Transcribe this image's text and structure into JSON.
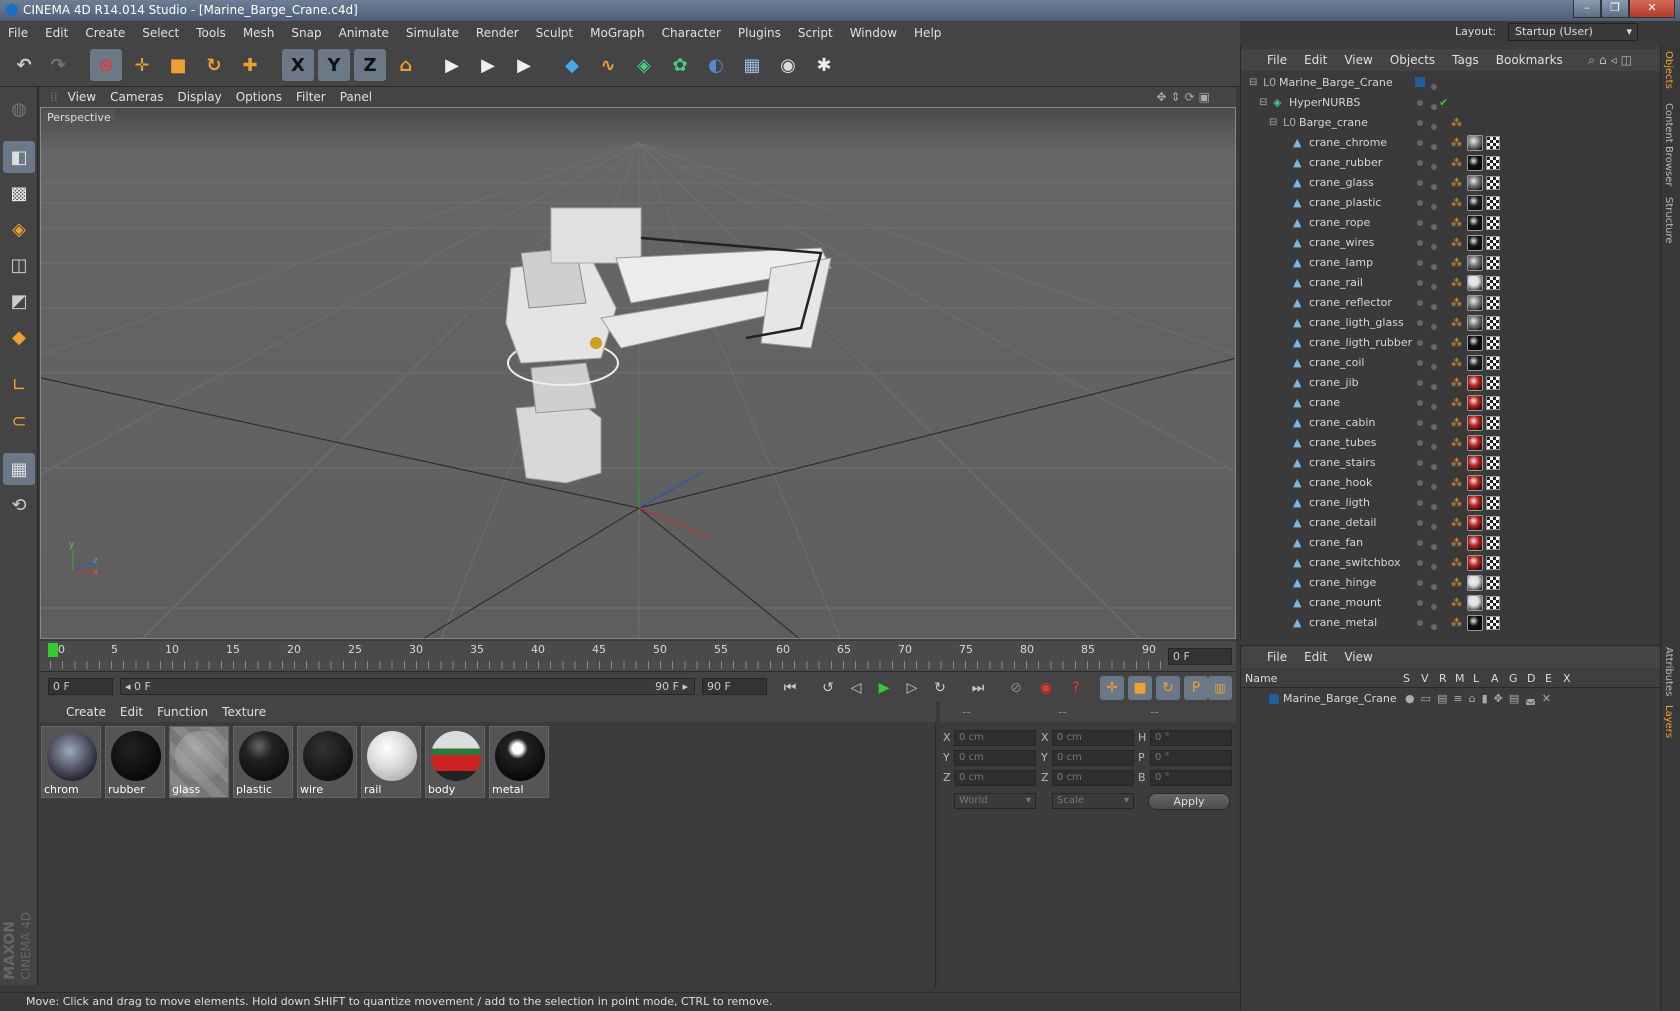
{
  "window": {
    "title": "CINEMA 4D R14.014 Studio - [Marine_Barge_Crane.c4d]",
    "minimize": "–",
    "maximize": "❐",
    "close": "✕"
  },
  "layout": {
    "label": "Layout:",
    "value": "Startup (User)"
  },
  "menubar": [
    "File",
    "Edit",
    "Create",
    "Select",
    "Tools",
    "Mesh",
    "Snap",
    "Animate",
    "Simulate",
    "Render",
    "Sculpt",
    "MoGraph",
    "Character",
    "Plugins",
    "Script",
    "Window",
    "Help"
  ],
  "toolbar": {
    "undo": "↶",
    "redo": "↷",
    "live_select": "⊙",
    "move": "✛",
    "scale": "■",
    "rotate": "↻",
    "add": "✚",
    "axis_x": "X",
    "axis_y": "Y",
    "axis_z": "Z",
    "coord": "⌂",
    "render_view": "▶",
    "render_pic": "▶",
    "render_settings": "▶",
    "cube": "◆",
    "spline": "∿",
    "nurbs": "◈",
    "array": "✿",
    "deformer": "◐",
    "floor": "▦",
    "camera": "◉",
    "light": "✱"
  },
  "viewport": {
    "menu": [
      "View",
      "Cameras",
      "Display",
      "Options",
      "Filter",
      "Panel"
    ],
    "label": "Perspective",
    "axis": {
      "x": "x",
      "y": "y",
      "z": "z"
    }
  },
  "timeline": {
    "ticks": [
      "0",
      "5",
      "10",
      "15",
      "20",
      "25",
      "30",
      "35",
      "40",
      "45",
      "50",
      "55",
      "60",
      "65",
      "70",
      "75",
      "80",
      "85",
      "90"
    ],
    "current_frame": "0 F",
    "start_field": "0 F",
    "range_start": "◂ 0 F",
    "range_end": "90 F ▸",
    "end_field": "90 F"
  },
  "materials": {
    "menu": [
      "Create",
      "Edit",
      "Function",
      "Texture"
    ],
    "items": [
      "chrom",
      "rubber",
      "glass",
      "plastic",
      "wire",
      "rail",
      "body",
      "metal"
    ]
  },
  "coordinates": {
    "headers": [
      "--",
      "--",
      "--"
    ],
    "rows": [
      {
        "a": "X",
        "av": "0 cm",
        "b": "X",
        "bv": "0 cm",
        "c": "H",
        "cv": "0 °"
      },
      {
        "a": "Y",
        "av": "0 cm",
        "b": "Y",
        "bv": "0 cm",
        "c": "P",
        "cv": "0 °"
      },
      {
        "a": "Z",
        "av": "0 cm",
        "b": "Z",
        "bv": "0 cm",
        "c": "B",
        "cv": "0 °"
      }
    ],
    "world": "World",
    "scale": "Scale",
    "apply": "Apply"
  },
  "brand": {
    "maxon": "MAXON",
    "product": "CINEMA 4D"
  },
  "status": "Move: Click and drag to move elements. Hold down SHIFT to quantize movement / add to the selection in point mode, CTRL to remove.",
  "objects": {
    "menu": [
      "File",
      "Edit",
      "View",
      "Objects",
      "Tags",
      "Bookmarks"
    ],
    "root": "Marine_Barge_Crane",
    "hypernurbs": "HyperNURBS",
    "barge": "Barge_crane",
    "children": [
      {
        "name": "crane_chrome",
        "mat": "#888"
      },
      {
        "name": "crane_rubber",
        "mat": "#111"
      },
      {
        "name": "crane_glass",
        "mat": "#777"
      },
      {
        "name": "crane_plastic",
        "mat": "#222"
      },
      {
        "name": "crane_rope",
        "mat": "#151515"
      },
      {
        "name": "crane_wires",
        "mat": "#1a1a1a"
      },
      {
        "name": "crane_lamp",
        "mat": "#777"
      },
      {
        "name": "crane_rail",
        "mat": "#ddd"
      },
      {
        "name": "crane_reflector",
        "mat": "#888"
      },
      {
        "name": "crane_ligth_glass",
        "mat": "#777"
      },
      {
        "name": "crane_ligth_rubber",
        "mat": "#111"
      },
      {
        "name": "crane_coil",
        "mat": "#222"
      },
      {
        "name": "crane_jib",
        "mat": "#b22"
      },
      {
        "name": "crane",
        "mat": "#b22"
      },
      {
        "name": "crane_cabin",
        "mat": "#b22"
      },
      {
        "name": "crane_tubes",
        "mat": "#b22"
      },
      {
        "name": "crane_stairs",
        "mat": "#b22"
      },
      {
        "name": "crane_hook",
        "mat": "#b22"
      },
      {
        "name": "crane_ligth",
        "mat": "#b22"
      },
      {
        "name": "crane_detail",
        "mat": "#b22"
      },
      {
        "name": "crane_fan",
        "mat": "#b22"
      },
      {
        "name": "crane_switchbox",
        "mat": "#b22"
      },
      {
        "name": "crane_hinge",
        "mat": "#ddd"
      },
      {
        "name": "crane_mount",
        "mat": "#ddd"
      },
      {
        "name": "crane_metal",
        "mat": "#111"
      }
    ]
  },
  "layers": {
    "menu": [
      "File",
      "Edit",
      "View"
    ],
    "columns": [
      "Name",
      "S",
      "V",
      "R",
      "M",
      "L",
      "A",
      "G",
      "D",
      "E",
      "X"
    ],
    "row": "Marine_Barge_Crane"
  },
  "sidetabs": {
    "top": [
      "Objects",
      "Content Browser",
      "Structure"
    ],
    "bottom": [
      "Attributes",
      "Layers"
    ]
  },
  "colors": {
    "accent": "#f0a030",
    "select_blue": "#6b7888",
    "layer_blue": "#1e5f9e"
  }
}
